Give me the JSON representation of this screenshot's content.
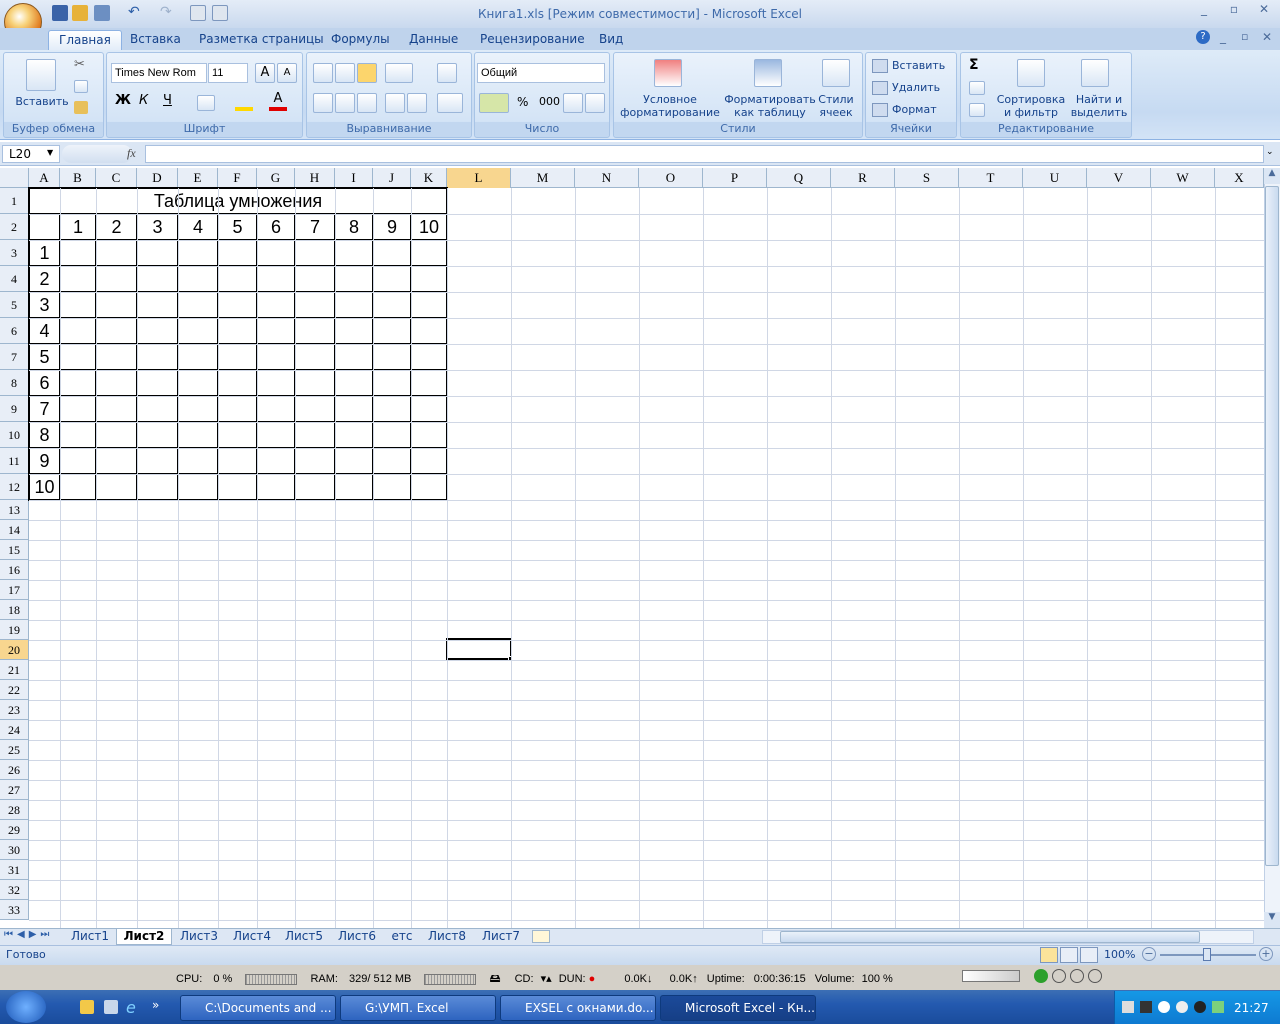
{
  "window": {
    "title": "Книга1.xls  [Режим совместимости] - Microsoft Excel"
  },
  "ribbon": {
    "tabs": [
      "Главная",
      "Вставка",
      "Разметка страницы",
      "Формулы",
      "Данные",
      "Рецензирование",
      "Вид"
    ],
    "active_tab": "Главная",
    "clipboard": {
      "label": "Буфер обмена",
      "paste": "Вставить"
    },
    "font": {
      "label": "Шрифт",
      "name": "Times New Rom",
      "size": "11",
      "bold": "Ж",
      "italic": "К",
      "underline": "Ч"
    },
    "alignment": {
      "label": "Выравнивание"
    },
    "number": {
      "label": "Число",
      "format": "Общий",
      "percent": "%",
      "thousands": "000"
    },
    "styles": {
      "label": "Стили",
      "conditional": "Условное форматирование",
      "as_table": "Форматировать как таблицу",
      "cell_styles": "Стили ячеек"
    },
    "cells": {
      "label": "Ячейки",
      "insert": "Вставить",
      "delete": "Удалить",
      "format": "Формат"
    },
    "editing": {
      "label": "Редактирование",
      "sort": "Сортировка и фильтр",
      "find": "Найти и выделить",
      "sum": "Σ"
    }
  },
  "formula_bar": {
    "name_box": "L20",
    "fx": "fx",
    "value": ""
  },
  "columns": [
    "A",
    "B",
    "C",
    "D",
    "E",
    "F",
    "G",
    "H",
    "I",
    "J",
    "K",
    "L",
    "M",
    "N",
    "O",
    "P",
    "Q",
    "R",
    "S",
    "T",
    "U",
    "V",
    "W",
    "X"
  ],
  "rows": [
    "1",
    "2",
    "3",
    "4",
    "5",
    "6",
    "7",
    "8",
    "9",
    "10",
    "11",
    "12",
    "13",
    "14",
    "15",
    "16",
    "17",
    "18",
    "19",
    "20",
    "21",
    "22",
    "23",
    "24",
    "25",
    "26",
    "27",
    "28",
    "29",
    "30",
    "31",
    "32",
    "33"
  ],
  "active_cell": {
    "column": "L",
    "row": "20"
  },
  "table": {
    "title": "Таблица умножения",
    "col_headers": [
      "1",
      "2",
      "3",
      "4",
      "5",
      "6",
      "7",
      "8",
      "9",
      "10"
    ],
    "row_headers": [
      "1",
      "2",
      "3",
      "4",
      "5",
      "6",
      "7",
      "8",
      "9",
      "10"
    ]
  },
  "sheets": [
    "Лист1",
    "Лист2",
    "Лист3",
    "Лист4",
    "Лист5",
    "Лист6",
    "етс",
    "Лист8",
    "Лист7"
  ],
  "active_sheet": "Лист2",
  "status": {
    "ready": "Готово",
    "zoom": "100%"
  },
  "perf": {
    "cpu_label": "CPU:",
    "cpu": "0 %",
    "ram_label": "RAM:",
    "ram": "329/ 512 MB",
    "cd": "CD:",
    "dun": "DUN:",
    "down": "0.0K",
    "up": "0.0K",
    "uptime_label": "Uptime:",
    "uptime": "0:00:36:15",
    "volume_label": "Volume:",
    "volume": "100 %"
  },
  "taskbar": {
    "items": [
      "C:\\Documents and ...",
      "G:\\УМП. Excel",
      "EXSEL с окнами.do...",
      "Microsoft Excel - Кн..."
    ],
    "clock": "21:27"
  }
}
